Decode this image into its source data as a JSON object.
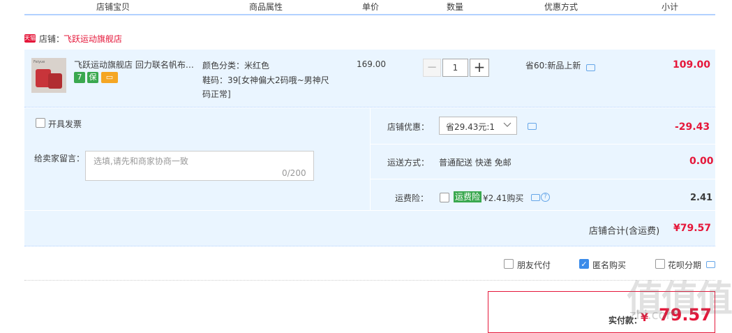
{
  "header": {
    "columns": [
      "店铺宝贝",
      "商品属性",
      "单价",
      "数量",
      "优惠方式",
      "小计"
    ]
  },
  "shop": {
    "badge": "天猫",
    "label": "店铺：",
    "name": "飞跃运动旗舰店"
  },
  "item": {
    "thumb_text": "Feiyue",
    "title": "飞跃运动旗舰店 回力联名帆布鞋女低帮",
    "icons": [
      {
        "name": "seven-day-return-icon",
        "glyph": "7",
        "color": "#3aa84f"
      },
      {
        "name": "insurance-icon",
        "glyph": "保",
        "color": "#3aa84f"
      },
      {
        "name": "card-icon",
        "glyph": "▭",
        "color": "#f5a623"
      }
    ],
    "attr_color": "颜色分类：米红色",
    "attr_size": "鞋码：39[女神偏大2码哦~男神尺码正常]",
    "unit_price": "169.00",
    "qty_minus": "−",
    "quantity": "1",
    "qty_plus": "+",
    "promo": "省60:新品上新",
    "subtotal": "109.00"
  },
  "options": {
    "invoice_label": "开具发票",
    "message_label": "给卖家留言：",
    "message_placeholder": "选填,请先和商家协商一致",
    "message_count": "0/200",
    "shop_discount_label": "店铺优惠：",
    "shop_discount_value": "省29.43元:1",
    "shop_discount_amount": "-29.43",
    "shipping_label": "运送方式：",
    "shipping_value": "普通配送 快递 免邮",
    "shipping_amount": "0.00",
    "insurance_label": "运费险：",
    "insurance_tag": "运费险",
    "insurance_price": "¥2.41购买",
    "insurance_q": "?",
    "insurance_amount": "2.41",
    "shop_total_label": "店铺合计(含运费)",
    "shop_total": "¥79.57"
  },
  "pay_options": {
    "friend_pay": "朋友代付",
    "anonymous": "匿名购买",
    "huabei": "花呗分期"
  },
  "payment": {
    "label": "实付款：",
    "currency": "¥",
    "amount": "79.57"
  },
  "watermark": {
    "mark": "值值值",
    "text": "zhi.com"
  },
  "colors": {
    "accent_red": "#e5173a",
    "panel_blue": "#eaf5ff",
    "header_line": "#b2d1ff",
    "link_blue": "#3a8bea"
  }
}
